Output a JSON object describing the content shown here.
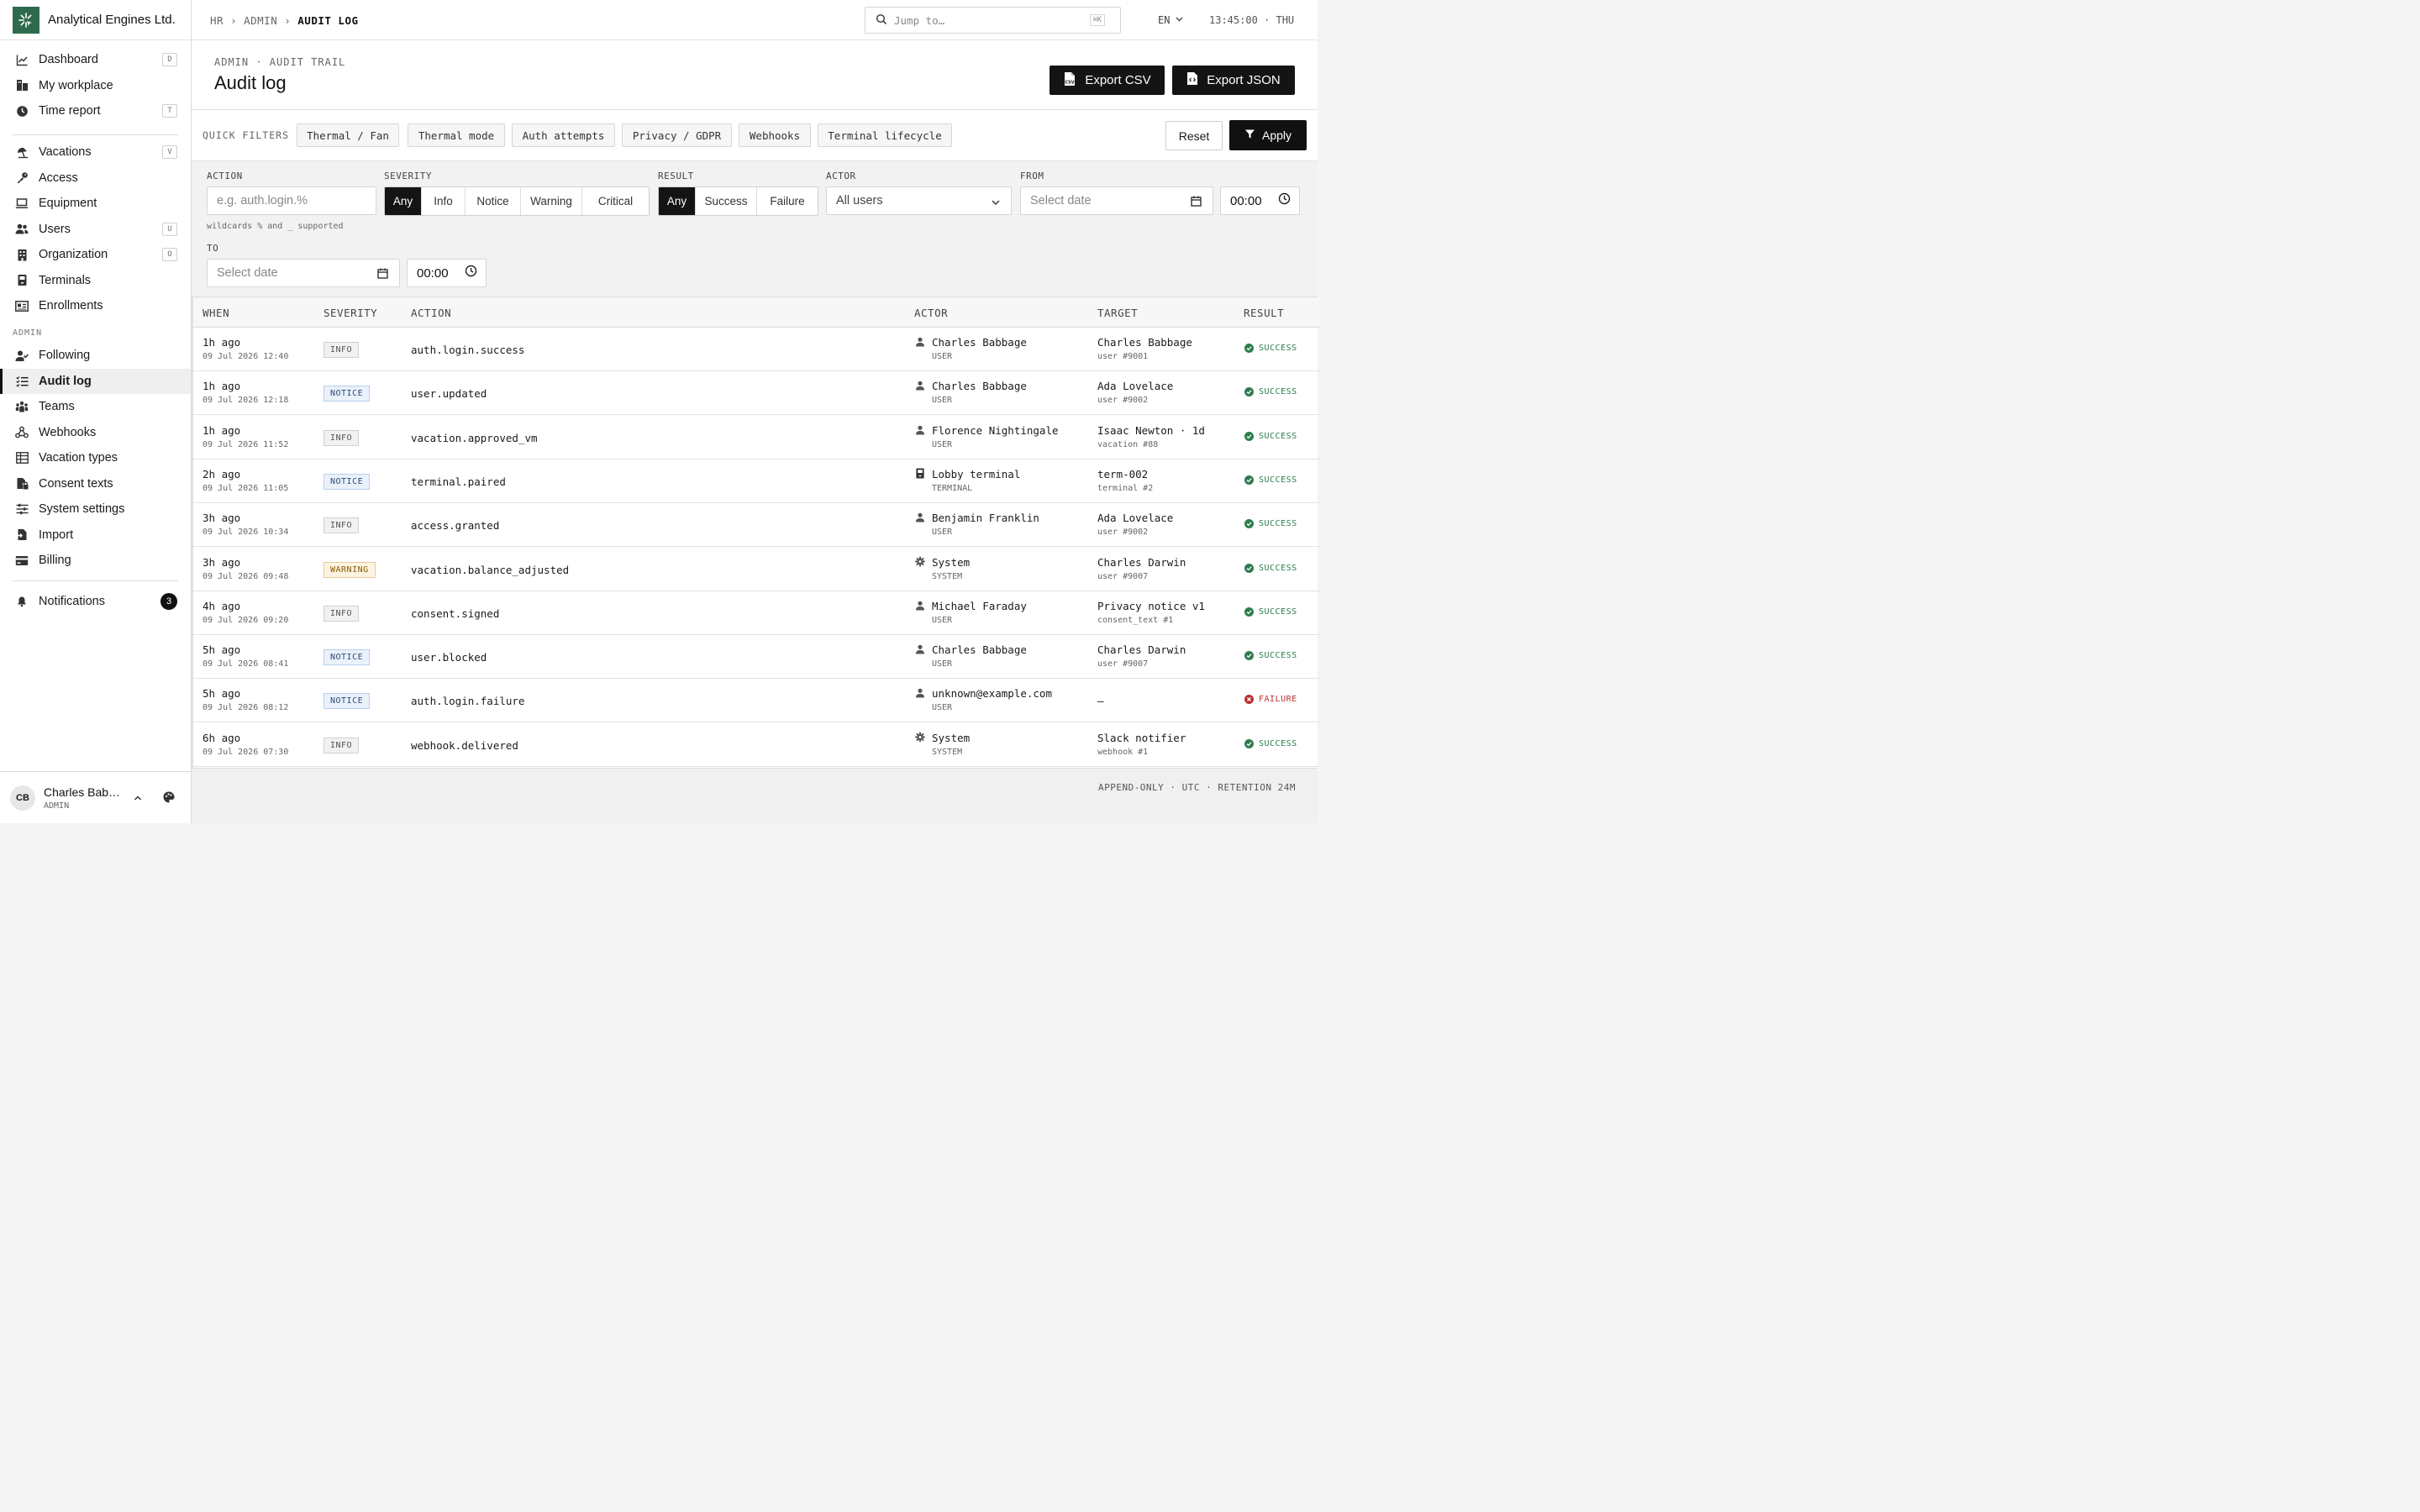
{
  "brand": {
    "name": "Analytical Engines Ltd."
  },
  "sidebar": {
    "primary": [
      {
        "label": "Dashboard",
        "icon": "chart-line-icon",
        "kbd": "D"
      },
      {
        "label": "My workplace",
        "icon": "workplace-icon",
        "kbd": ""
      },
      {
        "label": "Time report",
        "icon": "clock-icon",
        "kbd": "T"
      }
    ],
    "secondary": [
      {
        "label": "Vacations",
        "icon": "beach-icon",
        "kbd": "V"
      },
      {
        "label": "Access",
        "icon": "key-icon",
        "kbd": ""
      },
      {
        "label": "Equipment",
        "icon": "laptop-icon",
        "kbd": ""
      },
      {
        "label": "Users",
        "icon": "users-icon",
        "kbd": "U"
      },
      {
        "label": "Organization",
        "icon": "building-icon",
        "kbd": "O"
      },
      {
        "label": "Terminals",
        "icon": "terminal-icon",
        "kbd": ""
      },
      {
        "label": "Enrollments",
        "icon": "id-card-icon",
        "kbd": ""
      }
    ],
    "admin_section": "ADMIN",
    "admin": [
      {
        "label": "Following",
        "icon": "user-check-icon"
      },
      {
        "label": "Audit log",
        "icon": "list-check-icon",
        "active": true
      },
      {
        "label": "Teams",
        "icon": "team-icon"
      },
      {
        "label": "Webhooks",
        "icon": "webhook-icon"
      },
      {
        "label": "Vacation types",
        "icon": "table-icon"
      },
      {
        "label": "Consent texts",
        "icon": "file-lock-icon"
      },
      {
        "label": "System settings",
        "icon": "sliders-icon"
      },
      {
        "label": "Import",
        "icon": "file-import-icon"
      },
      {
        "label": "Billing",
        "icon": "credit-card-icon"
      }
    ],
    "notifications": {
      "label": "Notifications",
      "count": "3"
    },
    "user": {
      "initials": "CB",
      "name": "Charles Bab…",
      "role": "ADMIN"
    }
  },
  "topbar": {
    "crumbs": [
      "HR",
      "ADMIN",
      "AUDIT LOG"
    ],
    "separator": "›",
    "search_placeholder": "Jump to…",
    "search_kbd": "⌘K",
    "lang": "EN",
    "clock": "13:45:00 · THU"
  },
  "page": {
    "eyebrow": "ADMIN · AUDIT TRAIL",
    "title": "Audit log",
    "export_csv": "Export CSV",
    "export_json": "Export JSON"
  },
  "quick_filters": {
    "label": "QUICK FILTERS",
    "chips": [
      "Thermal / Fan",
      "Thermal mode",
      "Auth attempts",
      "Privacy / GDPR",
      "Webhooks",
      "Terminal lifecycle"
    ],
    "reset": "Reset",
    "apply": "Apply"
  },
  "filters": {
    "action_label": "ACTION",
    "action_placeholder": "e.g. auth.login.%",
    "action_hint": "wildcards % and _ supported",
    "severity_label": "SEVERITY",
    "severity_options": [
      "Any",
      "Info",
      "Notice",
      "Warning",
      "Critical"
    ],
    "result_label": "RESULT",
    "result_options": [
      "Any",
      "Success",
      "Failure"
    ],
    "actor_label": "ACTOR",
    "actor_value": "All users",
    "from_label": "FROM",
    "from_date_placeholder": "Select date",
    "from_time": "00:00",
    "to_label": "TO",
    "to_date_placeholder": "Select date",
    "to_time": "00:00"
  },
  "table": {
    "headers": [
      "WHEN",
      "SEVERITY",
      "ACTION",
      "ACTOR",
      "TARGET",
      "RESULT"
    ],
    "rows": [
      {
        "when": "1h ago",
        "when_abs": "09 Jul 2026 12:40",
        "severity": "INFO",
        "action": "auth.login.success",
        "actor": "Charles Babbage",
        "actor_type": "USER",
        "actor_icon": "user-icon",
        "target": "Charles Babbage",
        "target_sub": "user #9001",
        "result": "SUCCESS"
      },
      {
        "when": "1h ago",
        "when_abs": "09 Jul 2026 12:18",
        "severity": "NOTICE",
        "action": "user.updated",
        "actor": "Charles Babbage",
        "actor_type": "USER",
        "actor_icon": "user-icon",
        "target": "Ada Lovelace",
        "target_sub": "user #9002",
        "result": "SUCCESS"
      },
      {
        "when": "1h ago",
        "when_abs": "09 Jul 2026 11:52",
        "severity": "INFO",
        "action": "vacation.approved_vm",
        "actor": "Florence Nightingale",
        "actor_type": "USER",
        "actor_icon": "user-icon",
        "target": "Isaac Newton · 1d",
        "target_sub": "vacation #88",
        "result": "SUCCESS"
      },
      {
        "when": "2h ago",
        "when_abs": "09 Jul 2026 11:05",
        "severity": "NOTICE",
        "action": "terminal.paired",
        "actor": "Lobby terminal",
        "actor_type": "TERMINAL",
        "actor_icon": "terminal-icon",
        "target": "term-002",
        "target_sub": "terminal #2",
        "result": "SUCCESS"
      },
      {
        "when": "3h ago",
        "when_abs": "09 Jul 2026 10:34",
        "severity": "INFO",
        "action": "access.granted",
        "actor": "Benjamin Franklin",
        "actor_type": "USER",
        "actor_icon": "user-icon",
        "target": "Ada Lovelace",
        "target_sub": "user #9002",
        "result": "SUCCESS"
      },
      {
        "when": "3h ago",
        "when_abs": "09 Jul 2026 09:48",
        "severity": "WARNING",
        "action": "vacation.balance_adjusted",
        "actor": "System",
        "actor_type": "SYSTEM",
        "actor_icon": "gear-icon",
        "target": "Charles Darwin",
        "target_sub": "user #9007",
        "result": "SUCCESS"
      },
      {
        "when": "4h ago",
        "when_abs": "09 Jul 2026 09:20",
        "severity": "INFO",
        "action": "consent.signed",
        "actor": "Michael Faraday",
        "actor_type": "USER",
        "actor_icon": "user-icon",
        "target": "Privacy notice v1",
        "target_sub": "consent_text #1",
        "result": "SUCCESS"
      },
      {
        "when": "5h ago",
        "when_abs": "09 Jul 2026 08:41",
        "severity": "NOTICE",
        "action": "user.blocked",
        "actor": "Charles Babbage",
        "actor_type": "USER",
        "actor_icon": "user-icon",
        "target": "Charles Darwin",
        "target_sub": "user #9007",
        "result": "SUCCESS"
      },
      {
        "when": "5h ago",
        "when_abs": "09 Jul 2026 08:12",
        "severity": "NOTICE",
        "action": "auth.login.failure",
        "actor": "unknown@example.com",
        "actor_type": "USER",
        "actor_icon": "user-icon",
        "target": "—",
        "target_sub": "",
        "result": "FAILURE"
      },
      {
        "when": "6h ago",
        "when_abs": "09 Jul 2026 07:30",
        "severity": "INFO",
        "action": "webhook.delivered",
        "actor": "System",
        "actor_type": "SYSTEM",
        "actor_icon": "gear-icon",
        "target": "Slack notifier",
        "target_sub": "webhook #1",
        "result": "SUCCESS"
      }
    ]
  },
  "footer": {
    "text": "APPEND-ONLY · UTC · RETENTION 24M"
  },
  "colors": {
    "brand": "#2e6b4d",
    "dark": "#141414",
    "success": "#2e7d4f",
    "failure": "#b8312f"
  }
}
